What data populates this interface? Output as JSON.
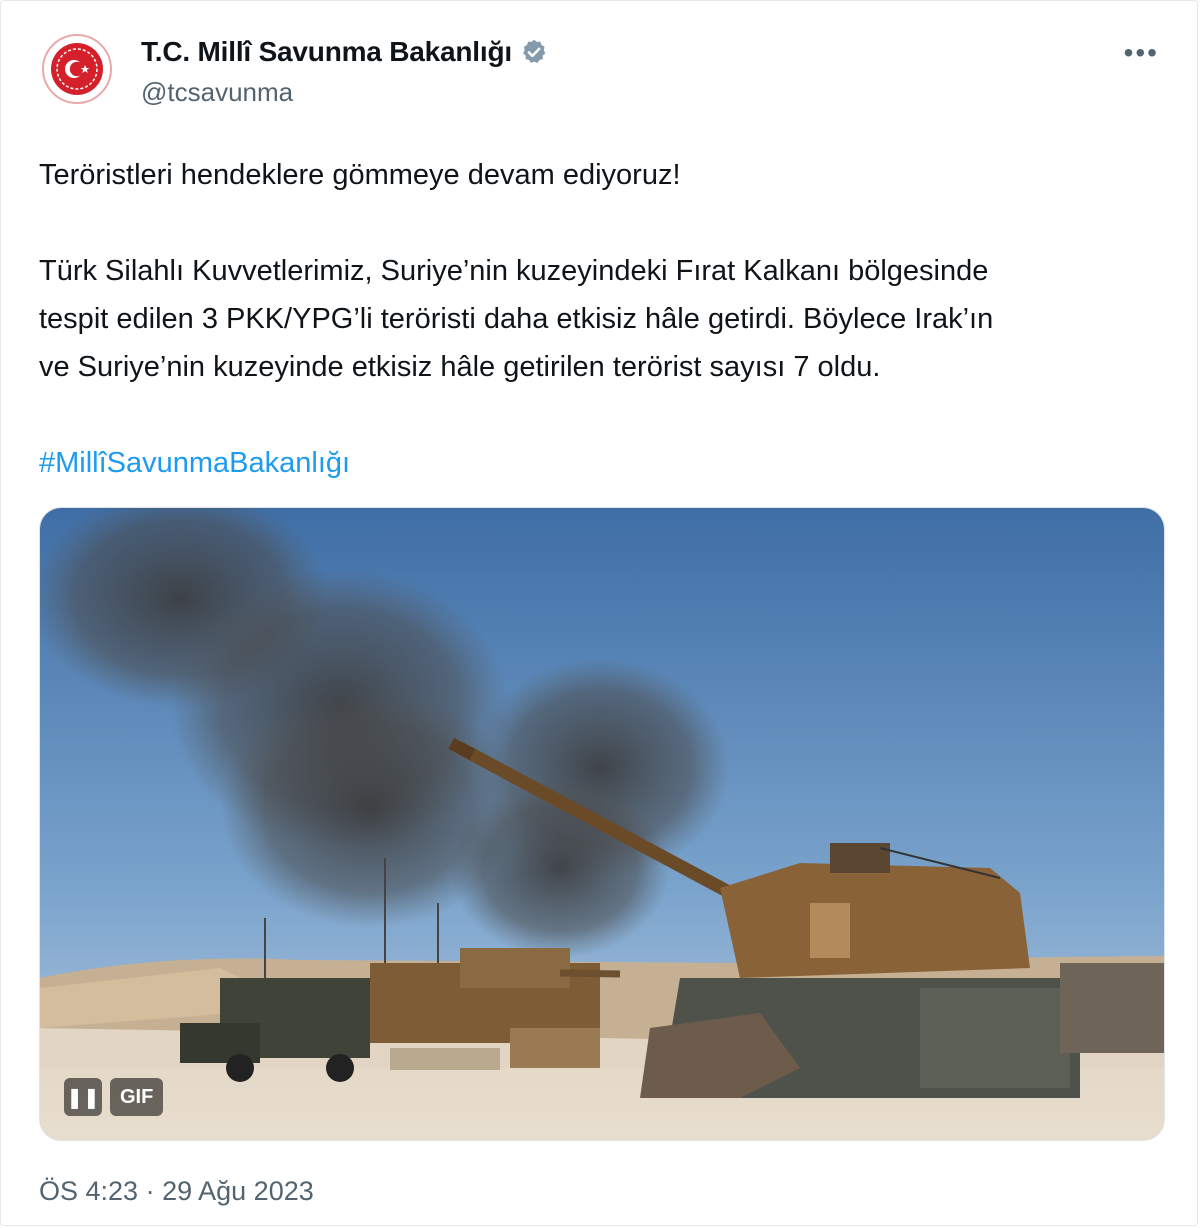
{
  "author": {
    "display_name": "T.C. Millî Savunma Bakanlığı",
    "handle": "@tcsavunma",
    "verified": true,
    "avatar_icon": "ministry-emblem-icon"
  },
  "menu": {
    "more_label": "•••"
  },
  "tweet": {
    "line1": "Teröristleri hendeklere gömmeye devam ediyoruz!",
    "paragraph2_line1": "Türk Silahlı Kuvvetlerimiz, Suriye’nin kuzeyindeki Fırat Kalkanı bölgesinde",
    "paragraph2_line2": "tespit edilen 3 PKK/YPG’li teröristi daha etkisiz hâle getirdi. Böylece Irak’ın",
    "paragraph2_line3": "ve Suriye’nin kuzeyinde etkisiz hâle getirilen terörist sayısı 7 oldu.",
    "hashtag": "#MillîSavunmaBakanlığı"
  },
  "media": {
    "type": "gif",
    "pause_label": "❚❚",
    "gif_label": "GIF"
  },
  "meta": {
    "time": "ÖS 4:23",
    "separator": "·",
    "date": "29 Ağu 2023"
  },
  "colors": {
    "accent": "#1d9bf0",
    "secondary_text": "#536471",
    "avatar_red": "#d4202a"
  }
}
